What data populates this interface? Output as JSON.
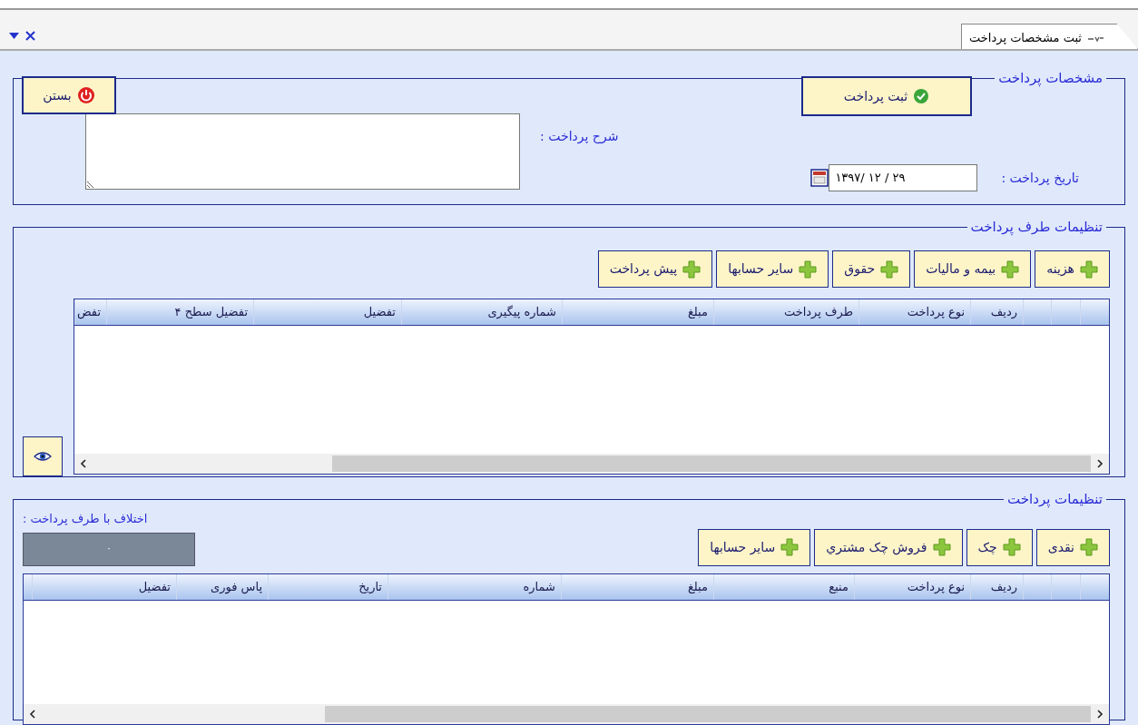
{
  "tab": {
    "title": "ثبت مشخصات پرداخت"
  },
  "payment_details": {
    "legend": "مشخصات پرداخت",
    "submit_button": "ثبت پرداخت",
    "close_button": "بستن",
    "description_label": "شرح پرداخت :",
    "date_label": "تاریخ پرداخت :",
    "date_value": "۱۳۹۷/ ۱۲ / ۲۹"
  },
  "counterparty_settings": {
    "legend": "تنظیمات طرف پرداخت",
    "add_buttons": [
      "هزینه",
      "بیمه و مالیات",
      "حقوق",
      "سایر حسابها",
      "پیش پرداخت"
    ],
    "table": {
      "columns": [
        "ردیف",
        "نوع پرداخت",
        "طرف پرداخت",
        "مبلغ",
        "شماره پیگیری",
        "تفضیل",
        "تفضیل سطح ۴",
        "تفض"
      ]
    }
  },
  "payment_settings": {
    "legend": "تنظیمات پرداخت",
    "difference_label": "اختلاف با طرف پرداخت :",
    "difference_value": "۰",
    "add_buttons": [
      "نقدی",
      "چک",
      "فروش چک مشتري",
      "سایر حسابها"
    ],
    "table": {
      "columns": [
        "ردیف",
        "نوع پرداخت",
        "منبع",
        "مبلغ",
        "شماره",
        "تاریخ",
        "پاس فوری",
        "تفضیل"
      ]
    }
  }
}
